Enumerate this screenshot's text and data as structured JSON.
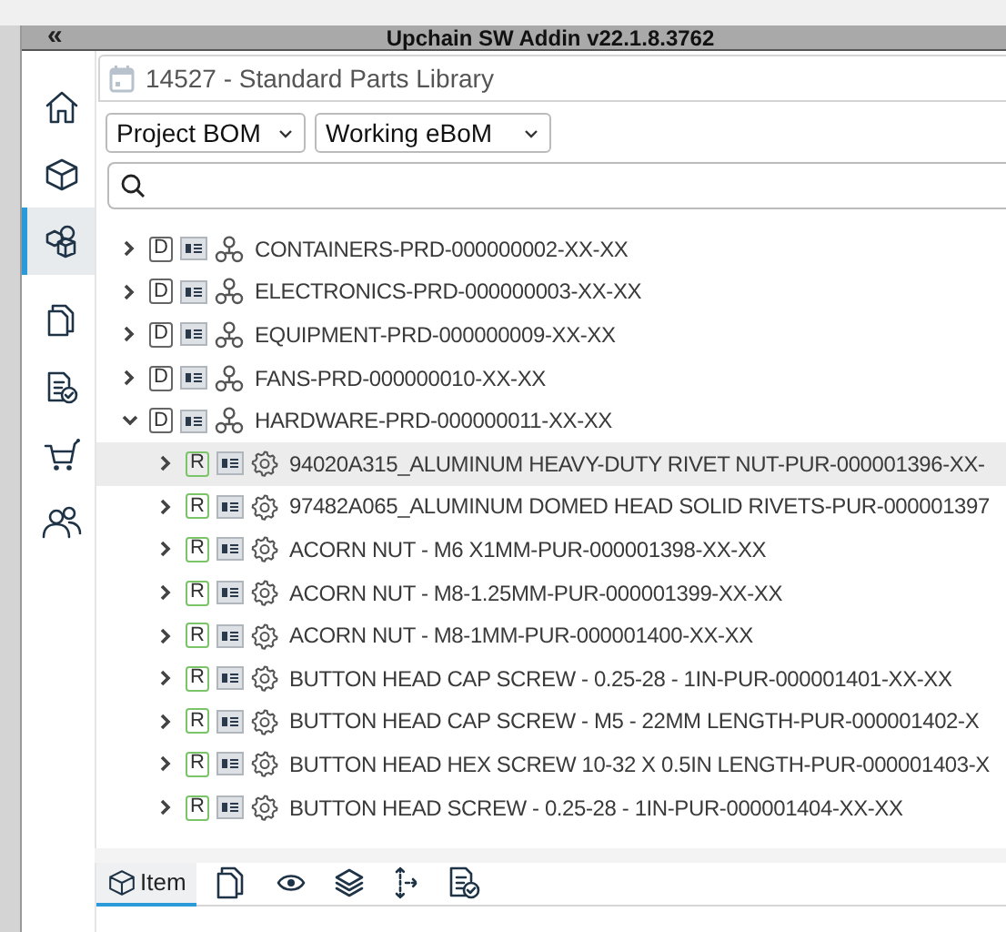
{
  "window": {
    "title": "Upchain SW Addin v22.1.8.3762",
    "collapse": "«"
  },
  "sidebar": {
    "items": [
      {
        "kind": "home",
        "selected": false
      },
      {
        "kind": "cube",
        "selected": false
      },
      {
        "kind": "assembly",
        "selected": true
      },
      {
        "kind": "copy",
        "selected": false
      },
      {
        "kind": "doc-check",
        "selected": false
      },
      {
        "kind": "cart",
        "selected": false
      },
      {
        "kind": "people",
        "selected": false
      }
    ]
  },
  "project": {
    "title": "14527 - Standard Parts Library"
  },
  "dropdowns": [
    {
      "value": "Project BOM"
    },
    {
      "value": "Working eBoM"
    }
  ],
  "tree": [
    {
      "badge": "D",
      "kind": "assembly",
      "label": "CONTAINERS-PRD-000000002-XX-XX",
      "expanded": false,
      "selected": false
    },
    {
      "badge": "D",
      "kind": "assembly",
      "label": "ELECTRONICS-PRD-000000003-XX-XX",
      "expanded": false,
      "selected": false
    },
    {
      "badge": "D",
      "kind": "assembly",
      "label": "EQUIPMENT-PRD-000000009-XX-XX",
      "expanded": false,
      "selected": false
    },
    {
      "badge": "D",
      "kind": "assembly",
      "label": "FANS-PRD-000000010-XX-XX",
      "expanded": false,
      "selected": false
    },
    {
      "badge": "D",
      "kind": "assembly",
      "label": "HARDWARE-PRD-000000011-XX-XX",
      "expanded": true,
      "selected": false,
      "children": [
        {
          "badge": "R",
          "kind": "part",
          "label": "94020A315_ALUMINUM HEAVY-DUTY RIVET NUT-PUR-000001396-XX-",
          "expanded": false,
          "selected": true
        },
        {
          "badge": "R",
          "kind": "part",
          "label": "97482A065_ALUMINUM DOMED HEAD SOLID RIVETS-PUR-000001397",
          "expanded": false,
          "selected": false
        },
        {
          "badge": "R",
          "kind": "part",
          "label": "ACORN NUT - M6 X1MM-PUR-000001398-XX-XX",
          "expanded": false,
          "selected": false
        },
        {
          "badge": "R",
          "kind": "part",
          "label": "ACORN NUT - M8-1.25MM-PUR-000001399-XX-XX",
          "expanded": false,
          "selected": false
        },
        {
          "badge": "R",
          "kind": "part",
          "label": "ACORN NUT - M8-1MM-PUR-000001400-XX-XX",
          "expanded": false,
          "selected": false
        },
        {
          "badge": "R",
          "kind": "part",
          "label": "BUTTON HEAD CAP SCREW - 0.25-28 - 1IN-PUR-000001401-XX-XX",
          "expanded": false,
          "selected": false
        },
        {
          "badge": "R",
          "kind": "part",
          "label": "BUTTON HEAD CAP SCREW - M5 - 22MM LENGTH-PUR-000001402-X",
          "expanded": false,
          "selected": false
        },
        {
          "badge": "R",
          "kind": "part",
          "label": "BUTTON HEAD HEX SCREW 10-32 X 0.5IN LENGTH-PUR-000001403-X",
          "expanded": false,
          "selected": false
        },
        {
          "badge": "R",
          "kind": "part",
          "label": "BUTTON HEAD SCREW - 0.25-28 - 1IN-PUR-000001404-XX-XX",
          "expanded": false,
          "selected": false
        }
      ]
    }
  ],
  "bottom_tabs": [
    {
      "kind": "item",
      "label": "Item",
      "selected": true
    },
    {
      "kind": "copy",
      "selected": false
    },
    {
      "kind": "eye",
      "selected": false
    },
    {
      "kind": "layers",
      "selected": false
    },
    {
      "kind": "move",
      "selected": false
    },
    {
      "kind": "doc-check",
      "selected": false
    }
  ]
}
